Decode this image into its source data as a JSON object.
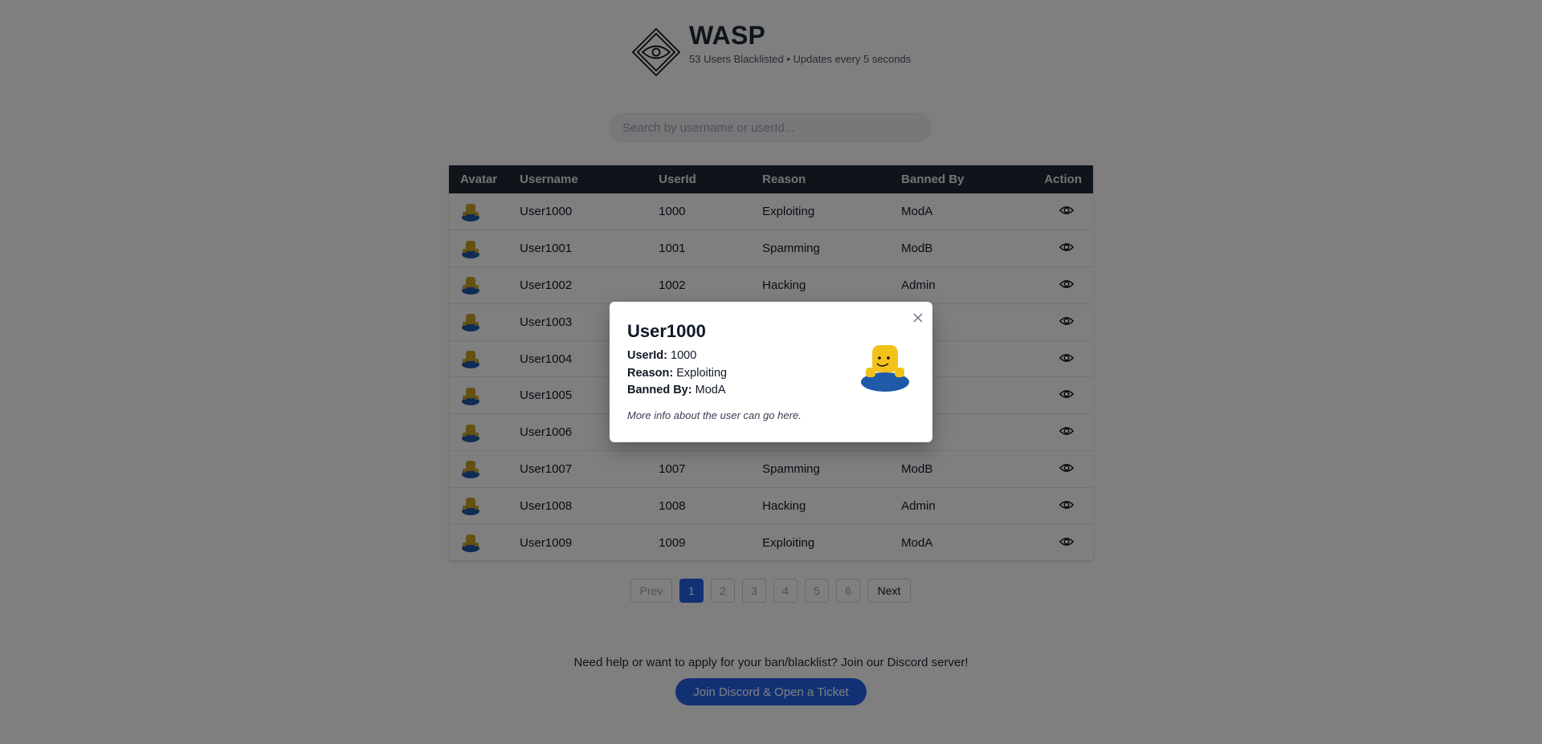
{
  "header": {
    "title": "WASP",
    "subtitle": "53 Users Blacklisted • Updates every 5 seconds"
  },
  "search": {
    "placeholder": "Search by username or userId...",
    "value": ""
  },
  "table": {
    "columns": [
      "Avatar",
      "Username",
      "UserId",
      "Reason",
      "Banned By",
      "Action"
    ],
    "rows": [
      {
        "username": "User1000",
        "userid": "1000",
        "reason": "Exploiting",
        "banned_by": "ModA"
      },
      {
        "username": "User1001",
        "userid": "1001",
        "reason": "Spamming",
        "banned_by": "ModB"
      },
      {
        "username": "User1002",
        "userid": "1002",
        "reason": "Hacking",
        "banned_by": "Admin"
      },
      {
        "username": "User1003",
        "userid": "",
        "reason": "",
        "banned_by": ""
      },
      {
        "username": "User1004",
        "userid": "",
        "reason": "",
        "banned_by": ""
      },
      {
        "username": "User1005",
        "userid": "",
        "reason": "",
        "banned_by": ""
      },
      {
        "username": "User1006",
        "userid": "",
        "reason": "",
        "banned_by": ""
      },
      {
        "username": "User1007",
        "userid": "1007",
        "reason": "Spamming",
        "banned_by": "ModB"
      },
      {
        "username": "User1008",
        "userid": "1008",
        "reason": "Hacking",
        "banned_by": "Admin"
      },
      {
        "username": "User1009",
        "userid": "1009",
        "reason": "Exploiting",
        "banned_by": "ModA"
      }
    ]
  },
  "pagination": {
    "prev": "Prev",
    "pages": [
      "1",
      "2",
      "3",
      "4",
      "5",
      "6"
    ],
    "current": "1",
    "next": "Next"
  },
  "footer": {
    "help_text": "Need help or want to apply for your ban/blacklist? Join our Discord server!",
    "discord_button": "Join Discord & Open a Ticket"
  },
  "modal": {
    "username": "User1000",
    "userid_label": "UserId:",
    "userid": "1000",
    "reason_label": "Reason:",
    "reason": "Exploiting",
    "banned_by_label": "Banned By:",
    "banned_by": "ModA",
    "note": "More info about the user can go here."
  },
  "colors": {
    "accent": "#2563eb",
    "table_header": "#1f2937",
    "overlay": "rgba(0,0,0,0.5)"
  },
  "icons": {
    "logo": "diamond-eye-logo",
    "action": "eye-icon",
    "close": "close-icon",
    "avatar": "noob-avatar"
  }
}
